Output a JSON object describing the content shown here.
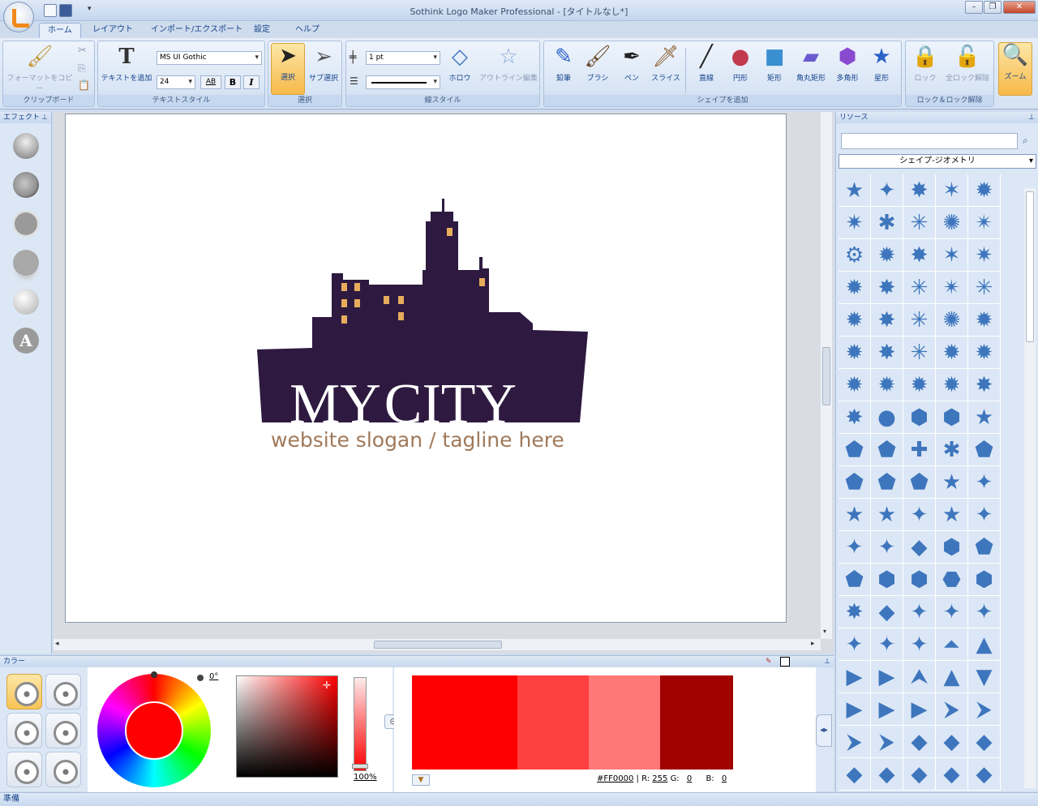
{
  "titlebar": {
    "title": "Sothink Logo Maker Professional - [タイトルなし*]"
  },
  "tabs": [
    "ホーム",
    "レイアウト",
    "インポート/エクスポート",
    "設定",
    "ヘルプ"
  ],
  "ribbon": {
    "clipboard": {
      "copy_format": "フォーマットをコピー",
      "caption": "クリップボード"
    },
    "text_style": {
      "add_text": "テキストを追加",
      "font": "MS UI Gothic",
      "size": "24",
      "spacing": "AB",
      "bold": "B",
      "italic": "I",
      "caption": "テキストスタイル"
    },
    "select": {
      "select": "選択",
      "sub_select": "サブ選択",
      "caption": "選択"
    },
    "line_style": {
      "width": "1 pt",
      "hollow": "ホロウ",
      "outline_edit": "アウトライン編集",
      "caption": "線スタイル"
    },
    "shapes": {
      "pencil": "鉛筆",
      "brush": "ブラシ",
      "pen": "ペン",
      "slice": "スライス",
      "line": "直線",
      "ellipse": "円形",
      "rect": "矩形",
      "round_rect": "角丸矩形",
      "polygon": "多角形",
      "star": "星形",
      "caption": "シェイプを追加"
    },
    "lock": {
      "lock": "ロック",
      "unlock_all": "全ロック解除",
      "caption": "ロック＆ロック解除"
    },
    "zoom": {
      "label": "ズーム"
    }
  },
  "effects": {
    "title": "エフェクト",
    "text_effect": "A"
  },
  "canvas": {
    "logo_title": "MyCITY",
    "title_my": "MY",
    "title_city": "CITY",
    "slogan": "website slogan / tagline here",
    "logo_color": "#2e1a40",
    "window_color": "#e6ac5c",
    "slogan_color": "#a0795a"
  },
  "resources": {
    "title": "リソース",
    "search_placeholder": "",
    "category": "シェイプ-ジオメトリ",
    "shape_color": "#3e76bd"
  },
  "color": {
    "title": "カラー",
    "angle": "0°",
    "opacity": "100",
    "opacity_unit": "%",
    "hex": "#FF0000",
    "r_label": "R:",
    "r": "255",
    "g_label": "G:",
    "g": "0",
    "b_label": "B:",
    "b": "0",
    "swatches": [
      "#ff0000",
      "#ff4040",
      "#ff7878",
      "#a00000"
    ]
  },
  "status": {
    "text": "準備"
  }
}
